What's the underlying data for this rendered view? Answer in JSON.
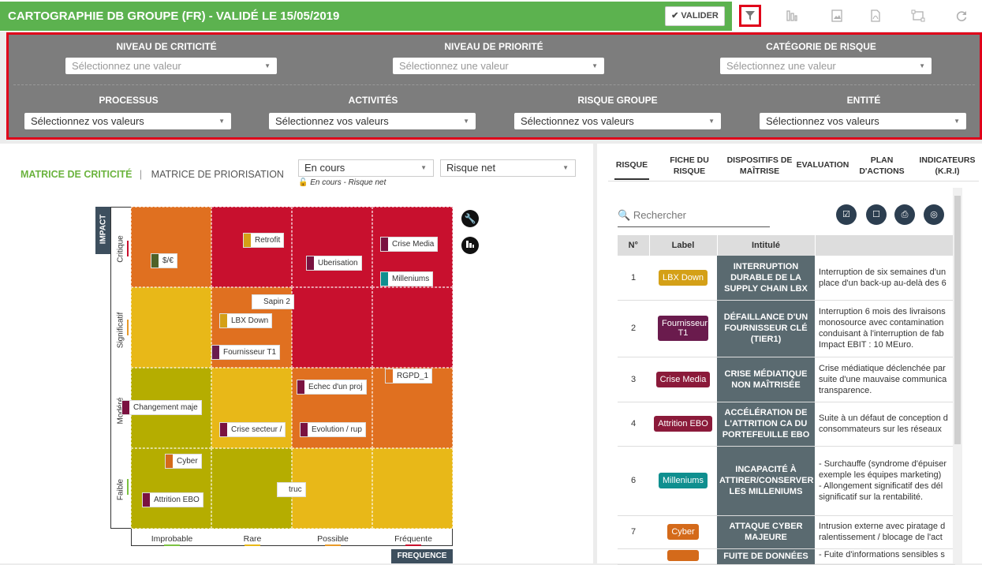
{
  "header": {
    "title": "CARTOGRAPHIE DB GROUPE (FR) - VALIDÉ LE 15/05/2019",
    "validate_label": "VALIDER"
  },
  "filters": {
    "row1": [
      {
        "label": "NIVEAU DE CRITICITÉ",
        "placeholder": "Sélectionnez une valeur"
      },
      {
        "label": "NIVEAU DE PRIORITÉ",
        "placeholder": "Sélectionnez une valeur"
      },
      {
        "label": "CATÉGORIE DE RISQUE",
        "placeholder": "Sélectionnez une valeur"
      }
    ],
    "row2": [
      {
        "label": "PROCESSUS",
        "placeholder": "Sélectionnez vos valeurs"
      },
      {
        "label": "ACTIVITÉS",
        "placeholder": "Sélectionnez vos valeurs"
      },
      {
        "label": "RISQUE GROUPE",
        "placeholder": "Sélectionnez vos valeurs"
      },
      {
        "label": "ENTITÉ",
        "placeholder": "Sélectionnez vos valeurs"
      }
    ]
  },
  "left": {
    "tab_active": "MATRICE DE CRITICITÉ",
    "tab_inactive": "MATRICE DE PRIORISATION",
    "select_status": "En cours",
    "select_type": "Risque net",
    "note": "En cours - Risque net",
    "impact_label": "IMPACT",
    "freq_label": "FREQUENCE",
    "y_levels": [
      "Critique",
      "Significatif",
      "Modéré",
      "Faible"
    ],
    "x_levels": [
      "Improbable",
      "Rare",
      "Possible",
      "Fréquente"
    ],
    "markers": [
      {
        "label": "$/€",
        "color": "#4f6228"
      },
      {
        "label": "Retrofit",
        "color": "#d4a017"
      },
      {
        "label": "Uberisation",
        "color": "#7a1240"
      },
      {
        "label": "Crise Media",
        "color": "#7a1240"
      },
      {
        "label": "Milleniums",
        "color": "#0f8f8f"
      },
      {
        "label": "Sapin 2",
        "color": "#ffffff"
      },
      {
        "label": "LBX Down",
        "color": "#d4a017"
      },
      {
        "label": "Fournisseur T1",
        "color": "#6a1b4d"
      },
      {
        "label": "RGPD_1",
        "color": "#e07020"
      },
      {
        "label": "Echec d'un proj",
        "color": "#7a1240"
      },
      {
        "label": "Changement maje",
        "color": "#7a1240"
      },
      {
        "label": "Crise secteur /",
        "color": "#7a1240"
      },
      {
        "label": "Evolution / rup",
        "color": "#7a1240"
      },
      {
        "label": "Cyber",
        "color": "#d46a1a"
      },
      {
        "label": "truc",
        "color": "#ffffff"
      },
      {
        "label": "Attrition EBO",
        "color": "#7a1240"
      }
    ]
  },
  "right": {
    "tabs": [
      "RISQUE",
      "FICHE DU RISQUE",
      "DISPOSITIFS DE MAÎTRISE",
      "EVALUATION",
      "PLAN D'ACTIONS",
      "INDICATEURS (K.R.I)"
    ],
    "search_placeholder": "Rechercher",
    "columns": [
      "N°",
      "Label",
      "Intitulé",
      ""
    ],
    "rows": [
      {
        "n": "1",
        "label": "LBX Down",
        "color": "#d4a017",
        "intitule": "INTERRUPTION DURABLE DE LA SUPPLY CHAIN LBX",
        "desc": [
          "Interruption de six semaines d'un",
          "place d'un back-up au-delà des 6"
        ]
      },
      {
        "n": "2",
        "label": "Fournisseur T1",
        "color": "#6a1b4d",
        "intitule": "DÉFAILLANCE D'UN FOURNISSEUR CLÉ (TIER1)",
        "desc": [
          "Interruption 6 mois des livraisons",
          "monosource avec contamination",
          "conduisant à l'interruption de fab",
          "Impact EBIT : 10 MEuro."
        ]
      },
      {
        "n": "3",
        "label": "Crise Media",
        "color": "#8b1a3a",
        "intitule": "CRISE MÉDIATIQUE NON MAÎTRISÉE",
        "desc": [
          "Crise médiatique déclenchée par",
          "suite d'une mauvaise communica",
          "transparence."
        ]
      },
      {
        "n": "4",
        "label": "Attrition EBO",
        "color": "#8b1a3a",
        "intitule": "ACCÉLÉRATION DE L'ATTRITION CA DU PORTEFEUILLE EBO",
        "desc": [
          "Suite à un défaut de conception d",
          "consommateurs sur les réseaux"
        ]
      },
      {
        "n": "6",
        "label": "Milleniums",
        "color": "#0f8f8f",
        "intitule": "INCAPACITÉ À ATTIRER/CONSERVER LES MILLENIUMS",
        "desc": [
          "- Surchauffe (syndrome d'épuiser",
          "exemple les équipes marketing)",
          "- Allongement significatif des dél",
          "significatif sur la rentabilité."
        ]
      },
      {
        "n": "7",
        "label": "Cyber",
        "color": "#d46a1a",
        "intitule": "ATTAQUE CYBER MAJEURE",
        "desc": [
          "Intrusion externe avec piratage d",
          "ralentissement / blocage de l'act"
        ]
      },
      {
        "n": "",
        "label": "",
        "color": "#d46a1a",
        "intitule": "FUITE DE DONNÉES",
        "desc": [
          "- Fuite d'informations sensibles s"
        ]
      }
    ]
  },
  "colors": {
    "green": "#5cb24f",
    "filter_bg": "#7d7d7d",
    "highlight": "#e0001a",
    "navy": "#3d4f5e",
    "red": "#c8102e",
    "orange": "#e07020",
    "yellow": "#e8b818",
    "olive": "#b5ad00"
  }
}
